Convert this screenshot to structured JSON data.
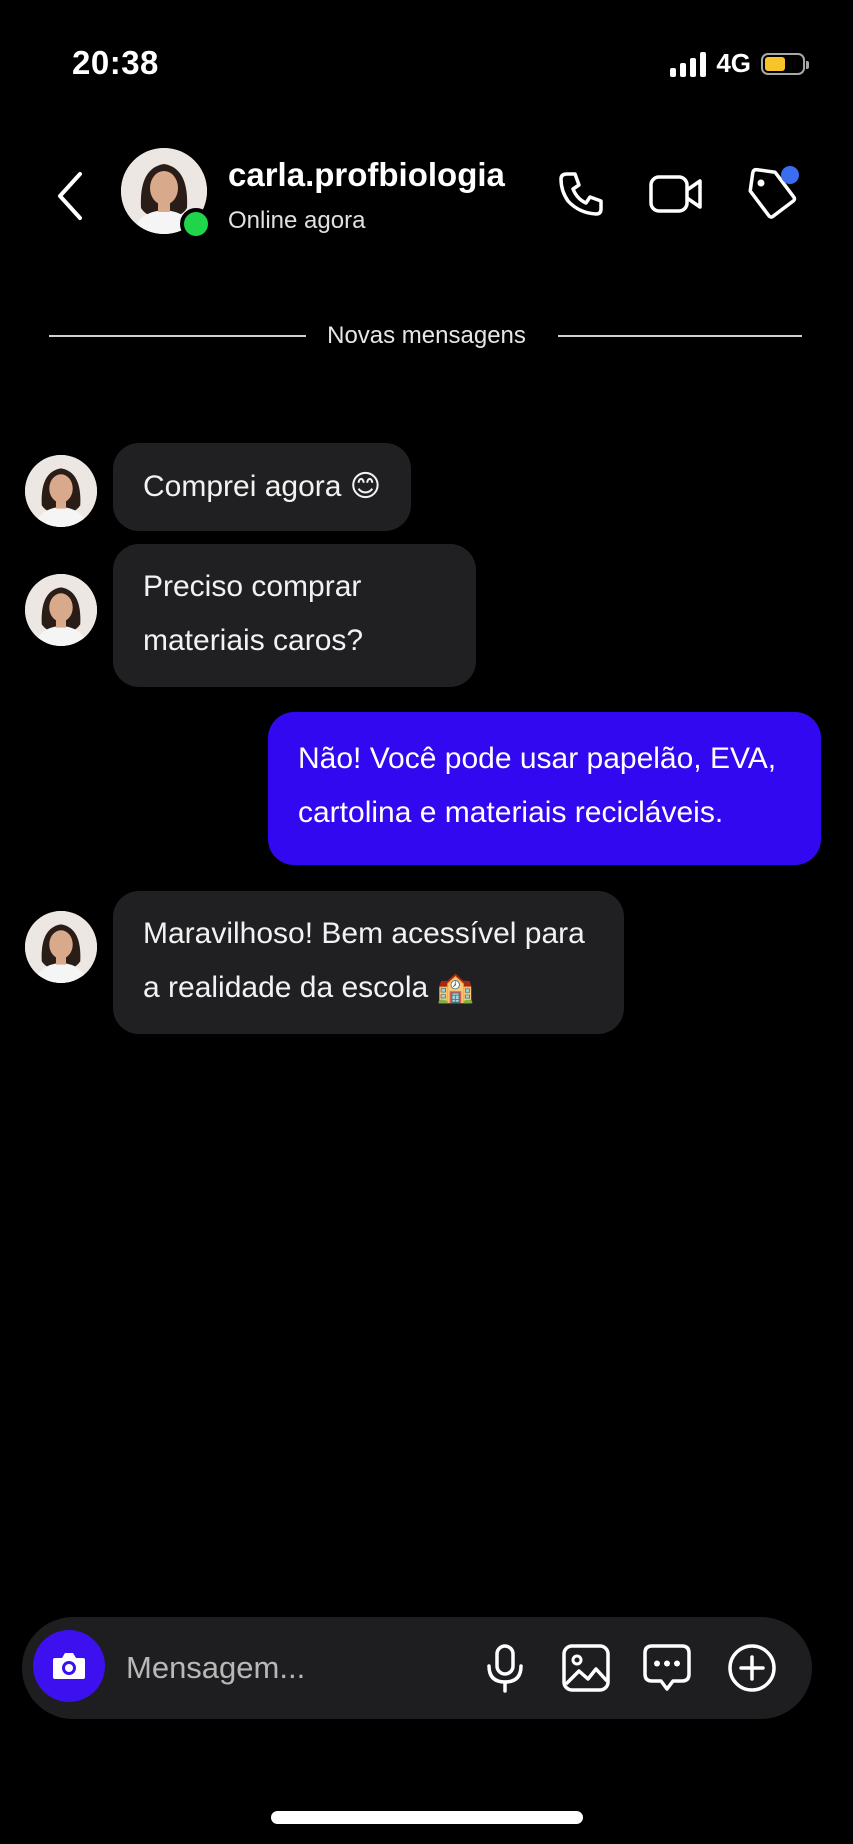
{
  "status_bar": {
    "time": "20:38",
    "network": "4G",
    "battery_level": 0.55,
    "battery_color": "#f7c42a"
  },
  "header": {
    "username": "carla.profbiologia",
    "status": "Online agora",
    "online_color": "#1fd64a"
  },
  "divider": {
    "label": "Novas mensagens"
  },
  "messages": [
    {
      "direction": "incoming",
      "text": "Comprei agora 😊"
    },
    {
      "direction": "incoming",
      "lines": [
        "Preciso comprar",
        "materiais caros?"
      ]
    },
    {
      "direction": "outgoing",
      "lines": [
        "Não! Você pode usar papelão, EVA,",
        "cartolina e materiais recicláveis."
      ]
    },
    {
      "direction": "incoming",
      "lines": [
        "Maravilhoso! Bem acessível para",
        "a realidade da escola 🏫"
      ]
    }
  ],
  "composer": {
    "placeholder": "Mensagem..."
  },
  "colors": {
    "accent": "#3208f0",
    "incoming_bubble": "#202022",
    "background": "#000000"
  },
  "icons": {
    "back": "chevron-left-icon",
    "call": "phone-icon",
    "video": "video-camera-icon",
    "tag": "tag-icon",
    "camera": "camera-icon",
    "mic": "microphone-icon",
    "gallery": "image-icon",
    "chat": "chat-bubble-icon",
    "add": "plus-circle-icon"
  }
}
